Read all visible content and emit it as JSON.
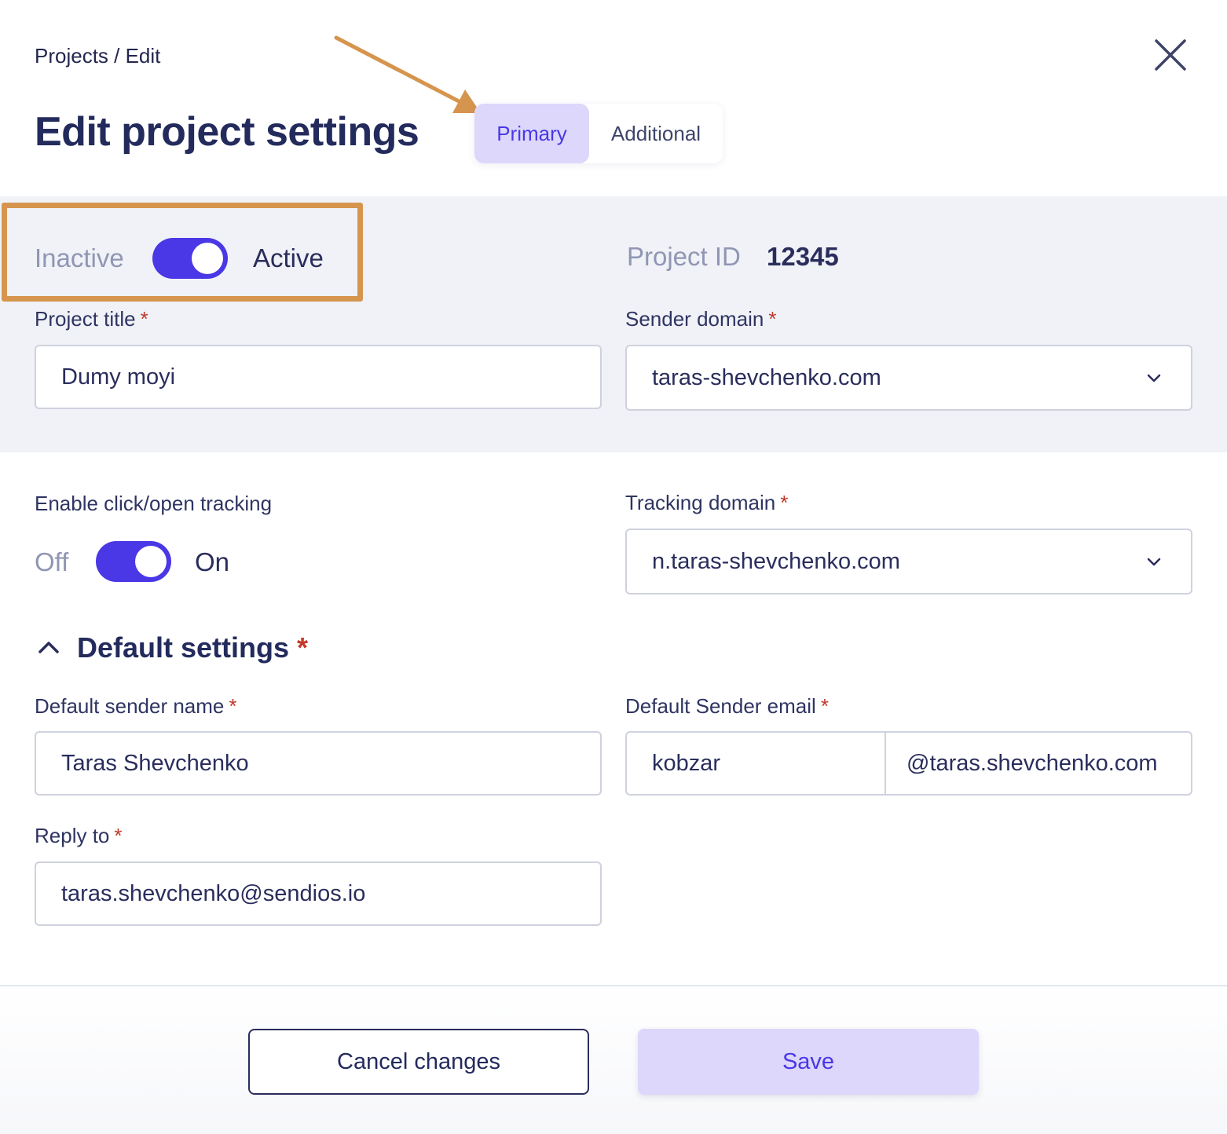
{
  "breadcrumb": "Projects / Edit",
  "page_title": "Edit project settings",
  "tabs": [
    {
      "label": "Primary",
      "selected": true
    },
    {
      "label": "Additional",
      "selected": false
    }
  ],
  "status_toggle": {
    "off_label": "Inactive",
    "on_label": "Active",
    "state": "on"
  },
  "project_id": {
    "label": "Project ID",
    "value": "12345"
  },
  "project_title": {
    "label": "Project title",
    "required": "*",
    "value": "Dumy moyi"
  },
  "sender_domain": {
    "label": "Sender domain",
    "required": "*",
    "value": "taras-shevchenko.com"
  },
  "tracking": {
    "label": "Enable click/open tracking",
    "off_label": "Off",
    "on_label": "On",
    "state": "on"
  },
  "tracking_domain": {
    "label": "Tracking domain",
    "required": "*",
    "value": "n.taras-shevchenko.com"
  },
  "default_settings": {
    "title": "Default settings",
    "required": "*",
    "expanded": true
  },
  "default_sender_name": {
    "label": "Default sender name",
    "required": "*",
    "value": "Taras Shevchenko"
  },
  "default_sender_email": {
    "label": "Default Sender email",
    "required": "*",
    "local_part": "kobzar",
    "domain_part": "@taras.shevchenko.com"
  },
  "reply_to": {
    "label": "Reply to",
    "required": "*",
    "value": "taras.shevchenko@sendios.io"
  },
  "footer": {
    "cancel_label": "Cancel changes",
    "save_label": "Save"
  },
  "colors": {
    "accent": "#4a37e6",
    "accent_soft": "#dcd7fb",
    "annotation": "#d6954e",
    "required": "#c0392b"
  },
  "icons": {
    "close": "close-icon",
    "chevron_down": "chevron-down-icon",
    "chevron_up": "chevron-up-icon",
    "arrow": "annotation-arrow"
  }
}
